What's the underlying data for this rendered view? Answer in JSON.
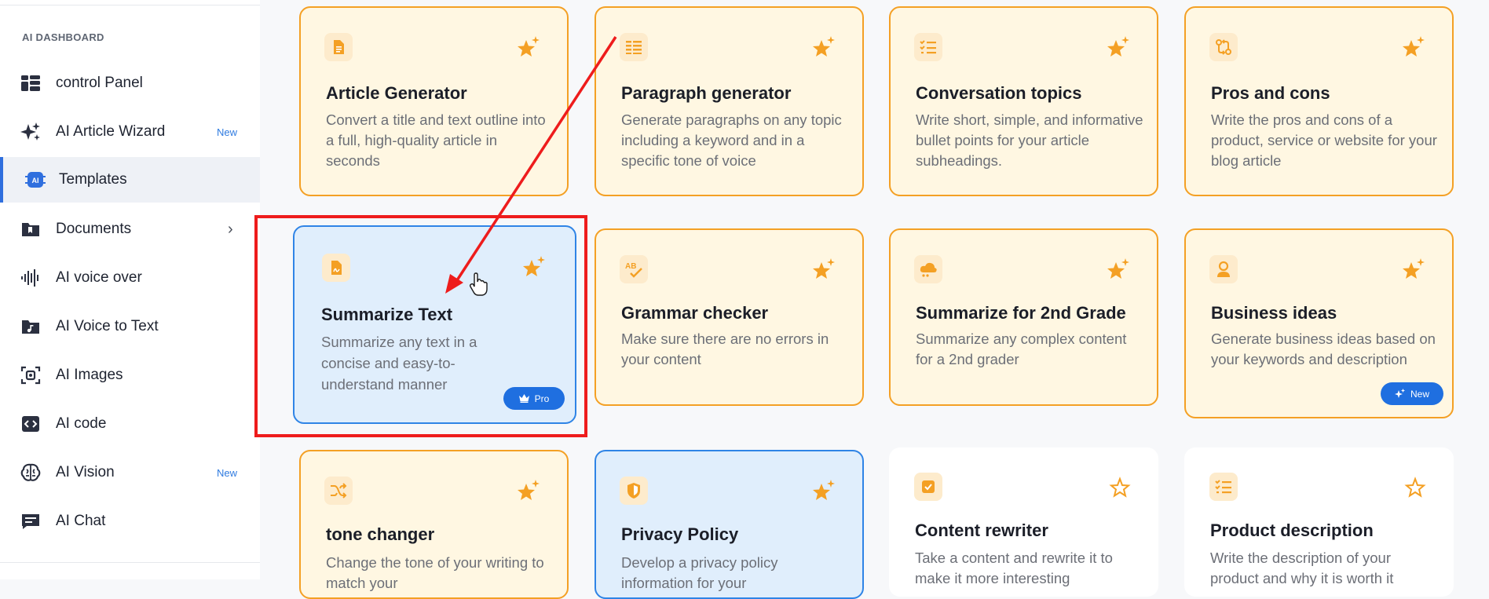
{
  "sidebar": {
    "section_title": "AI DASHBOARD",
    "items": [
      {
        "label": "control Panel",
        "icon": "dashboard-grid-icon",
        "badge": ""
      },
      {
        "label": "AI Article Wizard",
        "icon": "sparkles-icon",
        "badge": "New"
      },
      {
        "label": "Templates",
        "icon": "ai-chip-icon",
        "badge": ""
      },
      {
        "label": "Documents",
        "icon": "folder-icon",
        "badge": ""
      },
      {
        "label": "AI voice over",
        "icon": "waveform-icon",
        "badge": ""
      },
      {
        "label": "AI Voice to Text",
        "icon": "music-folder-icon",
        "badge": ""
      },
      {
        "label": "AI Images",
        "icon": "image-scan-icon",
        "badge": ""
      },
      {
        "label": "AI code",
        "icon": "code-icon",
        "badge": ""
      },
      {
        "label": "AI Vision",
        "icon": "brain-icon",
        "badge": "New"
      },
      {
        "label": "AI Chat",
        "icon": "chat-icon",
        "badge": ""
      }
    ],
    "documents_chevron": "›"
  },
  "cards": [
    {
      "title": "Article Generator",
      "desc": "Convert a title and text outline into a full, high-quality article in seconds",
      "icon": "document-icon",
      "style": "orange"
    },
    {
      "title": "Paragraph generator",
      "desc": "Generate paragraphs on any topic including a keyword and in a specific tone of voice",
      "icon": "paragraph-icon",
      "style": "orange"
    },
    {
      "title": "Conversation topics",
      "desc": "Write short, simple, and informative bullet points for your article subheadings.",
      "icon": "checklist-icon",
      "style": "orange"
    },
    {
      "title": "Pros and cons",
      "desc": "Write the pros and cons of a product, service or website for your blog article",
      "icon": "swap-icon",
      "style": "orange"
    },
    {
      "title": "Summarize Text",
      "desc": "Summarize any text in a concise and easy-to-understand manner",
      "icon": "pdf-file-icon",
      "style": "blue",
      "pill": "Pro"
    },
    {
      "title": "Grammar checker",
      "desc": "Make sure there are no errors in your content",
      "icon": "spellcheck-icon",
      "style": "orange"
    },
    {
      "title": "Summarize for 2nd Grade",
      "desc": "Summarize any complex content for a 2nd grader",
      "icon": "cloud-icon",
      "style": "orange"
    },
    {
      "title": "Business ideas",
      "desc": "Generate business ideas based on your keywords and description",
      "icon": "user-icon",
      "style": "orange",
      "pill": "New"
    },
    {
      "title": "tone changer",
      "desc": "Change the tone of your writing to match your",
      "icon": "shuffle-icon",
      "style": "orange"
    },
    {
      "title": "Privacy Policy",
      "desc": "Develop a privacy policy information for your",
      "icon": "shield-icon",
      "style": "blue"
    },
    {
      "title": "Content rewriter",
      "desc": "Take a content and rewrite it to make it more interesting",
      "icon": "checkbox-icon",
      "style": "white"
    },
    {
      "title": "Product description",
      "desc": "Write the description of your product and why it is worth it",
      "icon": "list-icon",
      "style": "white"
    }
  ],
  "colors": {
    "accent_orange": "#f4a024",
    "accent_blue": "#2f84e6",
    "highlight_red": "#ee1c1c"
  }
}
